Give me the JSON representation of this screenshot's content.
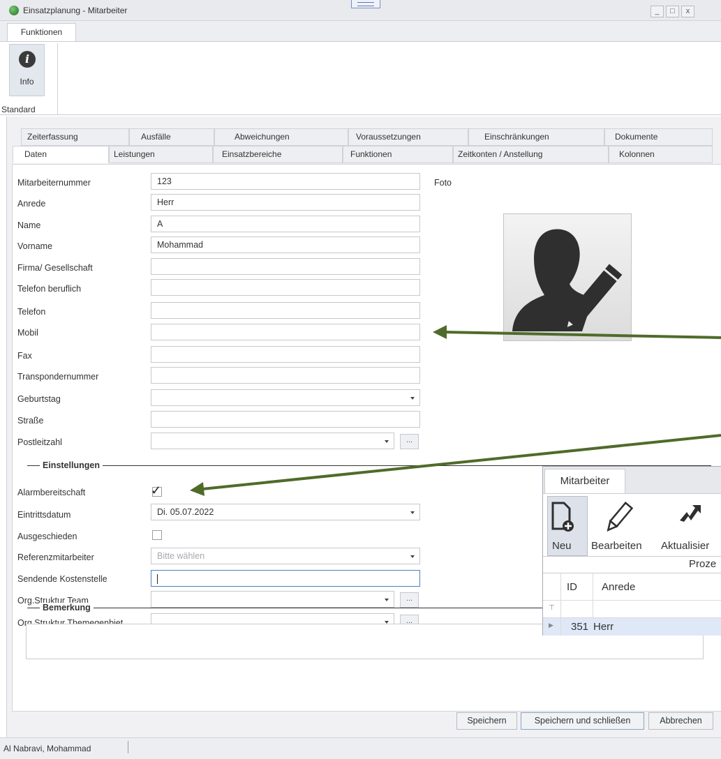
{
  "window": {
    "title": "Einsatzplanung - Mitarbeiter",
    "buttons": [
      "_",
      "□",
      "x"
    ]
  },
  "ribbon": {
    "tab": "Funktionen",
    "info_label": "Info",
    "info_icon": "info-icon",
    "group_label": "Standard"
  },
  "tabs": {
    "row1": [
      "Zeiterfassung",
      "Ausfälle",
      "Abweichungen",
      "Voraussetzungen",
      "Einschränkungen",
      "Dokumente"
    ],
    "row2": [
      "Daten",
      "Leistungen",
      "Einsatzbereiche",
      "Funktionen",
      "Zeitkonten / Anstellung",
      "Kolonnen"
    ]
  },
  "form": {
    "labels": {
      "mitarbeiternummer": "Mitarbeiternummer",
      "anrede": "Anrede",
      "name": "Name",
      "vorname": "Vorname",
      "firma": "Firma/ Gesellschaft",
      "telefon_beruflich": "Telefon beruflich",
      "telefon": "Telefon",
      "mobil": "Mobil",
      "fax": "Fax",
      "transpondernummer": "Transpondernummer",
      "geburtstag": "Geburtstag",
      "strasse": "Straße",
      "postleitzahl": "Postleitzahl",
      "alarmbereitschaft": "Alarmbereitschaft",
      "eintrittsdatum": "Eintrittsdatum",
      "ausgeschieden": "Ausgeschieden",
      "referenzmitarbeiter": "Referenzmitarbeiter",
      "sendende_kostenstelle": "Sendende Kostenstelle",
      "org_team": "Org.Struktur Team",
      "org_themengebiet": "Org.Struktur Themegenbiet"
    },
    "values": {
      "mitarbeiternummer": "123",
      "anrede": "Herr",
      "name": "A",
      "vorname": "Mohammad",
      "eintrittsdatum": "Di. 05.07.2022",
      "referenzmitarbeiter": "Bitte wählen",
      "alarmbereitschaft": true,
      "ausgeschieden": false
    },
    "foto_label": "Foto",
    "section_einstellungen": "Einstellungen",
    "section_bemerkung": "Bemerkung",
    "dots": "..."
  },
  "buttons": {
    "save": "Speichern",
    "save_close": "Speichern und schließen",
    "cancel": "Abbrechen"
  },
  "status": {
    "user": "Al Nabravi, Mohammad"
  },
  "overlay": {
    "tab": "Mitarbeiter",
    "neu": "Neu",
    "bearbeiten": "Bearbeiten",
    "aktualisieren": "Aktualisier",
    "group": "Proze",
    "columns": [
      "ID",
      "Anrede"
    ],
    "row": {
      "id": "351",
      "anrede": "Herr"
    }
  },
  "colors": {
    "arrow": "#4f6b2a",
    "selection": "#dfe8f7"
  }
}
